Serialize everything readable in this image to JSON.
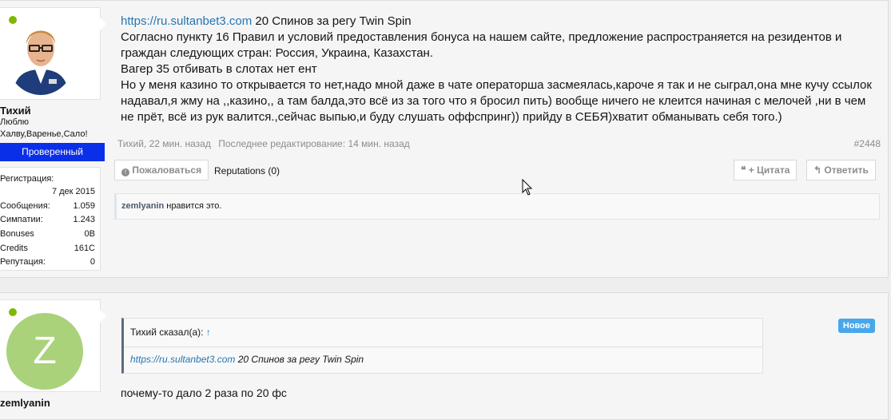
{
  "post1": {
    "user": {
      "name": "Тихий",
      "title_line1": "Люблю",
      "title_line2": "Халву,Варенье,Сало!",
      "badge": "Проверенный",
      "stats": [
        {
          "key": "Регистрация:",
          "value": ""
        },
        {
          "key": "",
          "value": "7 дек 2015"
        },
        {
          "key": "Сообщения:",
          "value": "1.059"
        },
        {
          "key": "Симпатии:",
          "value": "1.243"
        },
        {
          "key": "Bonuses",
          "value": "0B"
        },
        {
          "key": "Credits",
          "value": "161C"
        },
        {
          "key": "Репутация:",
          "value": "0"
        }
      ]
    },
    "message": {
      "link": "https://ru.sultanbet3.com",
      "line1_rest": " 20 Спинов за регу Twin Spin",
      "line2": "Согласно пункту 16 Правил и условий предоставления бонуса на нашем сайте, предложение распространяется на резидентов и граждан следующих стран: Россия, Украина, Казахстан.",
      "line3": "Вагер 35 отбивать в слотах нет ент",
      "line4": "Но у меня казино то открывается то нет,надо мной даже в чате операторша засмеялась,кароче я так и не сыграл,она мне кучу ссылок надавал,я жму на ,,казино,, а там балда,это всё из за того что я бросил пить) вообще ничего не клеится начиная с мелочей ,ни в чем не прёт, всё из рук валится.,сейчас выпью,и буду слушать оффспринг)) прийду в СЕБЯ)хватит обманывать себя того.)"
    },
    "meta": {
      "author_time": "Тихий, 22 мин. назад",
      "edited": "Последнее редактирование: 14 мин. назад",
      "post_number": "#2448"
    },
    "actions": {
      "report": "Пожаловаться",
      "reputations": "Reputations (0)",
      "quote": "+ Цитата",
      "reply": "Ответить"
    },
    "likes": {
      "user": "zemlyanin",
      "text": " нравится это."
    }
  },
  "post2": {
    "user": {
      "avatar_letter": "Z",
      "name": "zemlyanin"
    },
    "badge_new": "Новое",
    "quote": {
      "author": "Тихий сказал(а):",
      "up_arrow": "↑",
      "link": "https://ru.sultanbet3.com",
      "text": " 20 Спинов за регу Twin Spin"
    },
    "message": "почему-то дало 2 раза по 20 фс"
  },
  "colors": {
    "link": "#2577b1",
    "badge_blue": "#0a2fe8",
    "online": "#7fb900",
    "new_badge": "#47a7eb",
    "avatar_z": "#a9d27a"
  }
}
